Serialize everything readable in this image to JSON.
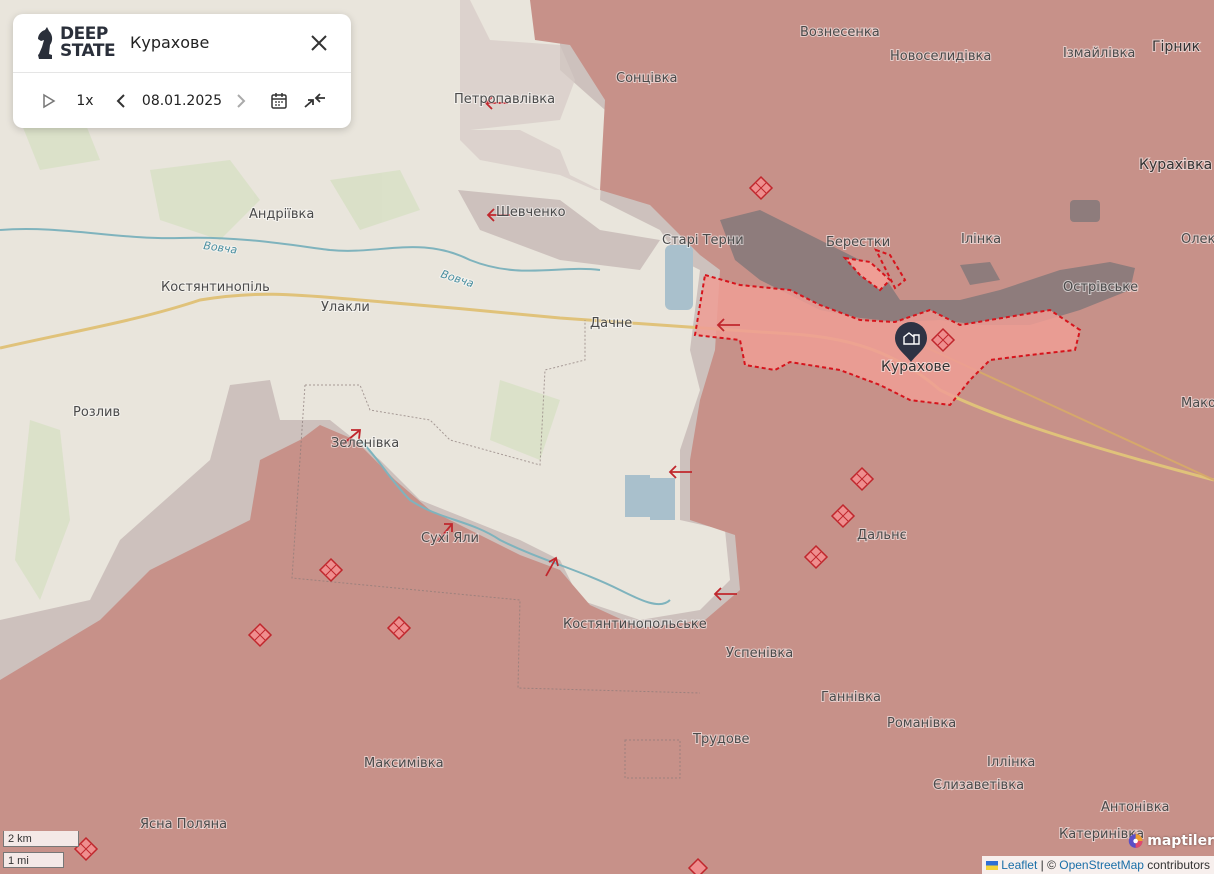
{
  "panel": {
    "logo_line1": "DEEP",
    "logo_line2": "STATE",
    "city": "Курахове",
    "speed": "1x",
    "date": "08.01.2025"
  },
  "places": {
    "voznesenka": "Вознесенка",
    "novoselidivka": "Новоселидівка",
    "izmailivka": "Ізмайлівка",
    "hirnyk": "Гірник",
    "sontsivka": "Сонцівка",
    "petropavlivka": "Петропавлівка",
    "kurakhivka": "Курахівка",
    "andriivka": "Андріївка",
    "shevchenko": "Шевченко",
    "stari_terny": "Старі Терни",
    "berestky": "Берестки",
    "illinka": "Ілінка",
    "olek": "Олек",
    "kostiantynopil": "Костянтинопіль",
    "ulakly": "Улакли",
    "dachne": "Дачне",
    "ostrivske": "Острівське",
    "kurakhove": "Курахове",
    "mako": "Мако",
    "rozlyv": "Розлив",
    "zelenivka": "Зеленівка",
    "dalnie": "Дальнє",
    "sukhi_yaly": "Сухі Яли",
    "kostiantynopolske": "Костянтинопольське",
    "uspenivka": "Успенівка",
    "hannivka": "Ганнівка",
    "romanivka": "Романівка",
    "trudove": "Трудове",
    "maksymivka": "Максимівка",
    "illinka2": "Іллінка",
    "yelyzavetivka": "Єлизаветівка",
    "antonivka": "Антонівка",
    "katerynivka": "Катеринівка",
    "yasna_poliana": "Ясна Поляна"
  },
  "rivers": {
    "vovcha1": "Вовча",
    "vovcha2": "Вовча"
  },
  "scale": {
    "km": "2 km",
    "mi": "1 mi"
  },
  "attribution": {
    "leaflet": "Leaflet",
    "sep": " | © ",
    "osm": "OpenStreetMap",
    "contributors": " contributors",
    "maptiler": "maptiler"
  },
  "colors": {
    "occupied": "#c9928a",
    "contested": "#cfc3bf",
    "free": "#e9e5dc",
    "encircled": "#ef9b93",
    "border_dash": "#d6141c",
    "water": "#8e7c7c"
  }
}
